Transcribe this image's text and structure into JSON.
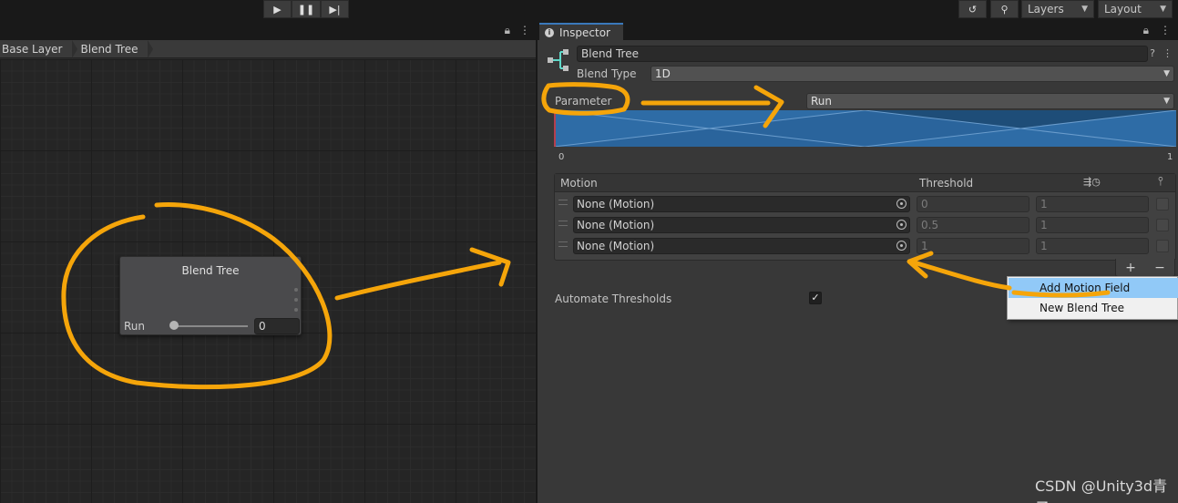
{
  "toolbar": {
    "play_icon": "play-icon",
    "pause_icon": "pause-icon",
    "step_icon": "step-icon",
    "history_icon": "history-icon",
    "search_icon": "search-icon",
    "layers_label": "Layers",
    "layout_label": "Layout"
  },
  "animator": {
    "breadcrumbs": [
      "Base Layer",
      "Blend Tree"
    ],
    "node": {
      "title": "Blend Tree",
      "param_label": "Run",
      "param_value": "0",
      "slider_level": 0
    }
  },
  "inspector": {
    "tab_label": "Inspector",
    "name_value": "Blend Tree",
    "blend_type_label": "Blend Type",
    "blend_type_value": "1D",
    "parameter_label": "Parameter",
    "parameter_value": "Run",
    "graph": {
      "min_label": "0",
      "max_label": "1",
      "thresholds": [
        0,
        0.5,
        1
      ]
    },
    "motion_list": {
      "header_motion": "Motion",
      "header_threshold": "Threshold",
      "rows": [
        {
          "motion": "None (Motion)",
          "threshold": "0",
          "speed": "1"
        },
        {
          "motion": "None (Motion)",
          "threshold": "0.5",
          "speed": "1"
        },
        {
          "motion": "None (Motion)",
          "threshold": "1",
          "speed": "1"
        }
      ],
      "add_label": "+",
      "remove_label": "−"
    },
    "automate_label": "Automate Thresholds",
    "automate_checked": "✓"
  },
  "context_menu": {
    "items": [
      "Add Motion Field",
      "New Blend Tree"
    ],
    "highlighted": "Add Motion Field"
  },
  "watermark": "CSDN @Unity3d青子",
  "colors": {
    "annotation": "#f5a50a",
    "graph_fill": "#1e4d78",
    "menu_highlight": "#91c9f7",
    "tab_accent": "#3a79bb"
  }
}
